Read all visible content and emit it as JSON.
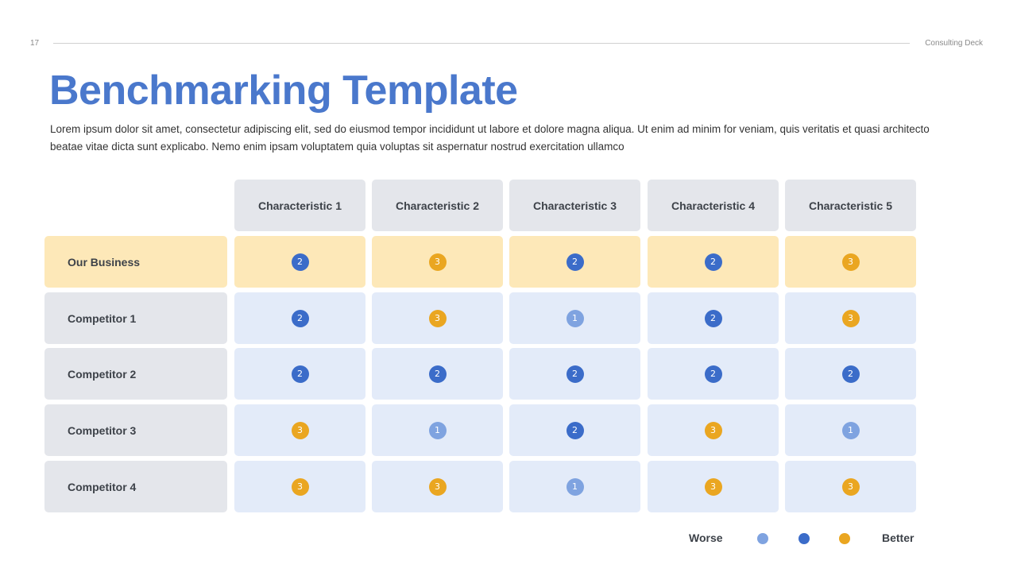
{
  "header": {
    "page_number": "17",
    "deck_name": "Consulting Deck"
  },
  "title": "Benchmarking Template",
  "description": "Lorem ipsum dolor sit amet, consectetur adipiscing elit, sed do eiusmod tempor incididunt ut labore et dolore magna aliqua.  Ut enim ad minim for veniam, quis veritatis et quasi architecto beatae vitae dicta sunt explicabo. Nemo enim ipsam voluptatem quia voluptas sit aspernatur nostrud exercitation ullamco",
  "columns": [
    "Characteristic 1",
    "Characteristic 2",
    "Characteristic 3",
    "Characteristic 4",
    "Characteristic 5"
  ],
  "rows": [
    {
      "label": "Our Business",
      "highlight": true,
      "scores": [
        2,
        3,
        2,
        2,
        3
      ]
    },
    {
      "label": "Competitor 1",
      "highlight": false,
      "scores": [
        2,
        3,
        1,
        2,
        3
      ]
    },
    {
      "label": "Competitor 2",
      "highlight": false,
      "scores": [
        2,
        2,
        2,
        2,
        2
      ]
    },
    {
      "label": "Competitor 3",
      "highlight": false,
      "scores": [
        3,
        1,
        2,
        3,
        1
      ]
    },
    {
      "label": "Competitor 4",
      "highlight": false,
      "scores": [
        3,
        3,
        1,
        3,
        3
      ]
    }
  ],
  "score_colors": {
    "1": "#7fa3e0",
    "2": "#3b6cc9",
    "3": "#eaa621"
  },
  "legend": {
    "worse_label": "Worse",
    "better_label": "Better",
    "scale": [
      1,
      2,
      3
    ]
  },
  "colors": {
    "title": "#4a78cc",
    "highlight_row": "#fde8b8",
    "cell": "#e3ebf9",
    "header_cell": "#e4e6eb"
  }
}
